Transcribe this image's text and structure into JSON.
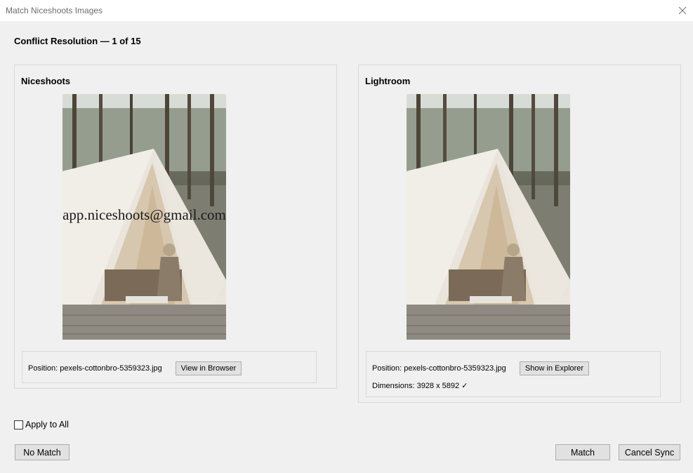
{
  "window": {
    "title": "Match Niceshoots Images",
    "close_icon": "close-icon"
  },
  "header": {
    "title": "Conflict Resolution — 1 of 15"
  },
  "niceshoots_panel": {
    "title": "Niceshoots",
    "watermark": "app.niceshoots@gmail.com",
    "position_text": "Position: pexels-cottonbro-5359323.jpg",
    "action_label": "View in Browser"
  },
  "lightroom_panel": {
    "title": "Lightroom",
    "position_text": "Position: pexels-cottonbro-5359323.jpg",
    "action_label": "Show in Explorer",
    "dimensions_text": "Dimensions: 3928 x 5892 ✓"
  },
  "apply_all": {
    "label": "Apply to All",
    "checked": false
  },
  "footer": {
    "no_match_label": "No Match",
    "match_label": "Match",
    "cancel_label": "Cancel Sync"
  },
  "colors": {
    "dialog_bg": "#f0f0f0",
    "titlebar_bg": "#ffffff",
    "button_bg": "#e1e1e1",
    "button_border": "#adadad",
    "panel_border": "#d9d9d9"
  }
}
